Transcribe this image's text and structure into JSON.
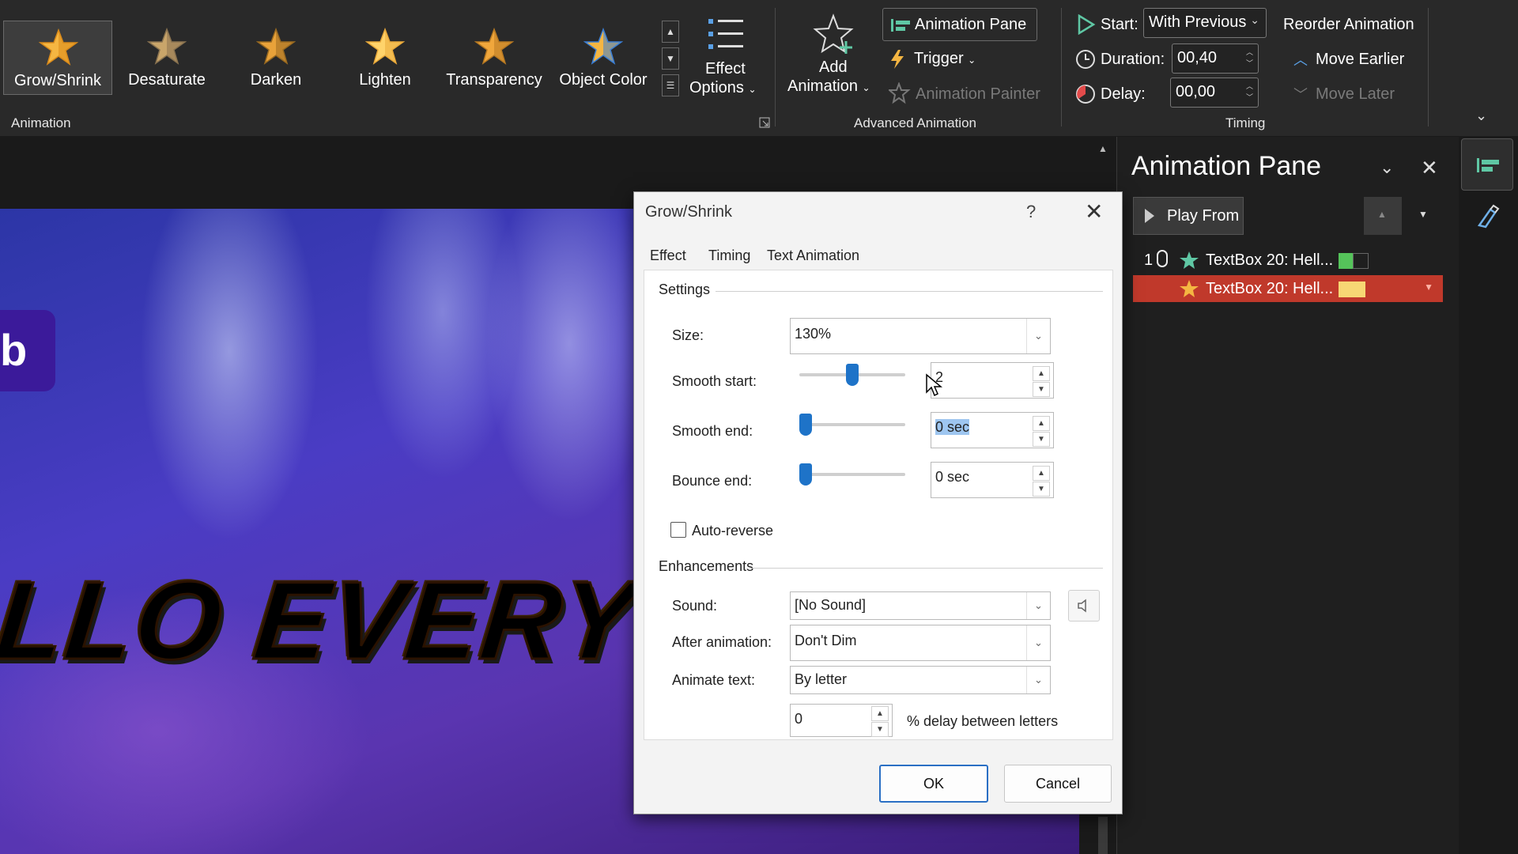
{
  "ribbon": {
    "gallery": [
      {
        "label": "Grow/Shrink",
        "icon": "grow-shrink-star-icon",
        "selected": true
      },
      {
        "label": "Desaturate",
        "icon": "desaturate-star-icon"
      },
      {
        "label": "Darken",
        "icon": "darken-star-icon"
      },
      {
        "label": "Lighten",
        "icon": "lighten-star-icon"
      },
      {
        "label": "Transparency",
        "icon": "transparency-star-icon"
      },
      {
        "label": "Object Color",
        "icon": "object-color-star-icon"
      }
    ],
    "effect_options_line1": "Effect",
    "effect_options_line2": "Options",
    "animation_group_label": "Animation",
    "add_animation_line1": "Add",
    "add_animation_line2": "Animation",
    "animation_pane_btn": "Animation Pane",
    "trigger_btn": "Trigger",
    "animation_painter_btn": "Animation Painter",
    "advanced_animation_label": "Advanced Animation",
    "start_label": "Start:",
    "start_value": "With Previous",
    "duration_label": "Duration:",
    "duration_value": "00,40",
    "delay_label": "Delay:",
    "delay_value": "00,00",
    "timing_group_label": "Timing",
    "reorder_label": "Reorder Animation",
    "move_earlier": "Move Earlier",
    "move_later": "Move Later"
  },
  "slide": {
    "tab_letter": "b",
    "headline": "LLO EVERYONE"
  },
  "animation_pane": {
    "title": "Animation Pane",
    "play_from": "Play From",
    "items": [
      {
        "order": "1",
        "label": "TextBox 20: Hell...",
        "bar_color": "#55c35a",
        "selected": false
      },
      {
        "order": "",
        "label": "TextBox 20: Hell...",
        "bar_color": "#f7d774",
        "selected": true
      }
    ]
  },
  "dialog": {
    "title": "Grow/Shrink",
    "help": "?",
    "tabs": [
      "Effect",
      "Timing",
      "Text Animation"
    ],
    "settings_label": "Settings",
    "size_label": "Size:",
    "size_value": "130%",
    "smooth_start_label": "Smooth start:",
    "smooth_start_value": "2",
    "smooth_start_level": 0.5,
    "smooth_end_label": "Smooth end:",
    "smooth_end_value": "0 sec",
    "smooth_end_level": 0,
    "bounce_end_label": "Bounce end:",
    "bounce_end_value": "0 sec",
    "bounce_end_level": 0,
    "auto_reverse_label": "Auto-reverse",
    "auto_reverse_checked": false,
    "enhancements_label": "Enhancements",
    "sound_label": "Sound:",
    "sound_value": "[No Sound]",
    "after_animation_label": "After animation:",
    "after_animation_value": "Don't Dim",
    "animate_text_label": "Animate text:",
    "animate_text_value": "By letter",
    "delay_letters_value": "0",
    "delay_letters_label": "% delay between letters",
    "ok": "OK",
    "cancel": "Cancel"
  },
  "colors": {
    "accent_blue": "#1e73c8",
    "selection_red": "#c0392b",
    "ribbon_bg": "#292929"
  }
}
